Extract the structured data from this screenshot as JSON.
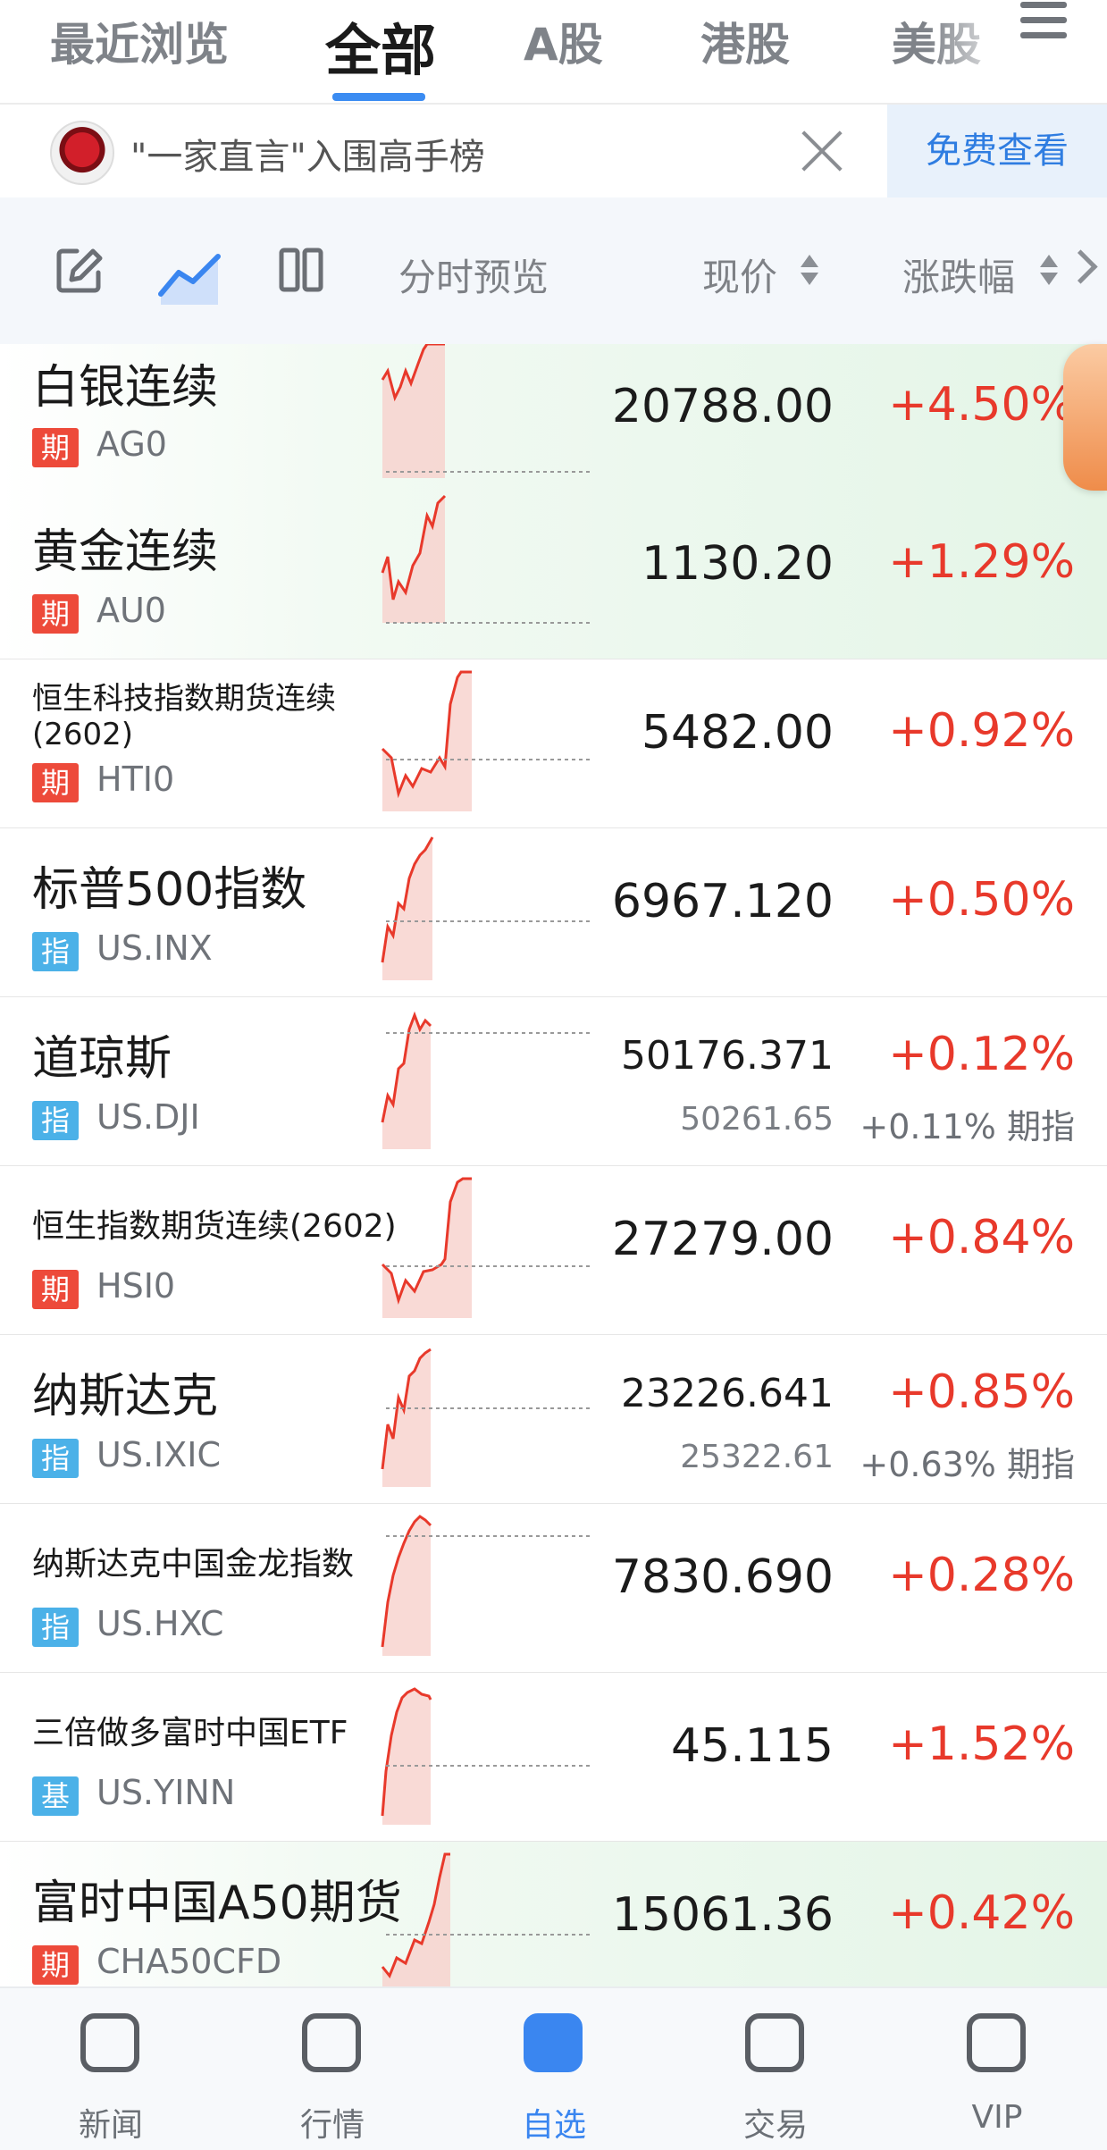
{
  "tabs": [
    {
      "label": "最近浏览",
      "active": false
    },
    {
      "label": "全部",
      "active": true
    },
    {
      "label": "A股",
      "active": false
    },
    {
      "label": "港股",
      "active": false
    },
    {
      "label": "美股",
      "active": false
    }
  ],
  "banner": {
    "text": "\"一家直言\"入围高手榜",
    "button_label": "免费查看"
  },
  "header": {
    "preview_label": "分时预览",
    "price_label": "现价",
    "change_label": "涨跌幅"
  },
  "colors": {
    "accent": "#3a86f0",
    "up": "#e8392b",
    "futures_badge": "#ed4a3a",
    "index_badge": "#4bb1e8"
  },
  "rows": [
    {
      "name": "白银连续",
      "badge": "期",
      "code": "AG0",
      "price": "20788.00",
      "change": "+4.50%",
      "highlight": true
    },
    {
      "name": "黄金连续",
      "badge": "期",
      "code": "AU0",
      "price": "1130.20",
      "change": "+1.29%",
      "highlight": true
    },
    {
      "name": "恒生科技指数期货连续(2602)",
      "badge": "期",
      "code": "HTI0",
      "price": "5482.00",
      "change": "+0.92%",
      "highlight": false
    },
    {
      "name": "标普500指数",
      "badge": "指",
      "code": "US.INX",
      "price": "6967.120",
      "change": "+0.50%",
      "highlight": false
    },
    {
      "name": "道琼斯",
      "badge": "指",
      "code": "US.DJI",
      "price": "50176.371",
      "change": "+0.12%",
      "sub_price": "50261.65",
      "sub_change": "+0.11% 期指",
      "highlight": false
    },
    {
      "name": "恒生指数期货连续(2602)",
      "badge": "期",
      "code": "HSI0",
      "price": "27279.00",
      "change": "+0.84%",
      "highlight": false
    },
    {
      "name": "纳斯达克",
      "badge": "指",
      "code": "US.IXIC",
      "price": "23226.641",
      "change": "+0.85%",
      "sub_price": "25322.61",
      "sub_change": "+0.63% 期指",
      "highlight": false
    },
    {
      "name": "纳斯达克中国金龙指数",
      "badge": "指",
      "code": "US.HXC",
      "price": "7830.690",
      "change": "+0.28%",
      "highlight": false
    },
    {
      "name": "三倍做多富时中国ETF",
      "badge": "基",
      "code": "US.YINN",
      "price": "45.115",
      "change": "+1.52%",
      "highlight": false
    },
    {
      "name": "富时中国A50期货",
      "badge": "期",
      "code": "CHA50CFD",
      "price": "15061.36",
      "change": "+0.42%",
      "highlight": true
    }
  ],
  "bottom_nav": [
    {
      "label": "新闻",
      "icon": "news-icon",
      "active": false
    },
    {
      "label": "行情",
      "icon": "market-chart-icon",
      "active": false
    },
    {
      "label": "自选",
      "icon": "plus-icon",
      "active": true
    },
    {
      "label": "交易",
      "icon": "exchange-icon",
      "active": false
    },
    {
      "label": "VIP",
      "icon": "vip-icon",
      "active": false
    }
  ]
}
